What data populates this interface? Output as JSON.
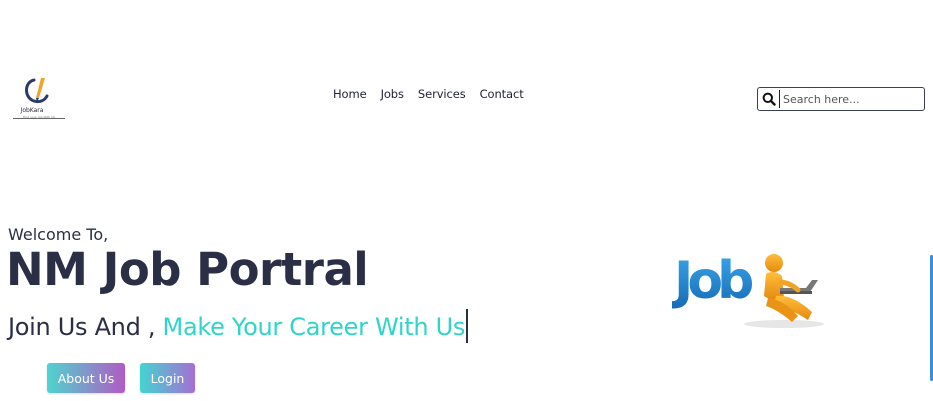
{
  "header": {
    "logo_text": "JobKara",
    "logo_tagline": "Find your Job With Us",
    "nav": [
      {
        "label": "Home"
      },
      {
        "label": "Jobs"
      },
      {
        "label": "Services"
      },
      {
        "label": "Contact"
      }
    ],
    "search": {
      "placeholder": "Search here...",
      "value": ""
    }
  },
  "hero": {
    "welcome": "Welcome To,",
    "title": "NM Job Portral",
    "tagline_static": "Join Us And ,",
    "tagline_typed": "Make Your Career With Us",
    "about_button": "About Us",
    "login_button": "Login",
    "illustration_word": "Job"
  },
  "colors": {
    "text_dark": "#2b2f45",
    "accent_teal": "#2fd5c8",
    "button_gradient_start": "#4fd3cf",
    "button_gradient_end": "#b15bc4",
    "illustration_blue": "#1f8fd6",
    "illustration_orange": "#f5a01a"
  },
  "icons": {
    "search": "search-icon",
    "logo": "briefcase-pencil-logo-icon"
  }
}
